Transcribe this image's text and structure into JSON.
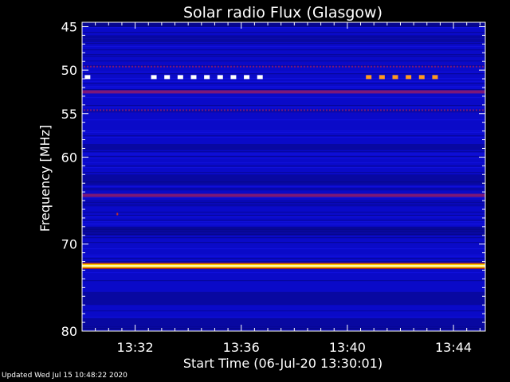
{
  "chart_data": {
    "type": "heatmap",
    "title": "Solar radio Flux (Glasgow)",
    "xlabel": "Start Time (06-Jul-20 13:30:01)",
    "ylabel": "Frequency [MHz]",
    "xlim_minutes": [
      0,
      15.2
    ],
    "ylim_mhz": [
      44.5,
      80
    ],
    "y_inverted": true,
    "x_ticks": [
      {
        "minutes": 2,
        "label": "13:32"
      },
      {
        "minutes": 6,
        "label": "13:36"
      },
      {
        "minutes": 10,
        "label": "13:40"
      },
      {
        "minutes": 14,
        "label": "13:44"
      }
    ],
    "y_ticks": [
      {
        "mhz": 45,
        "label": "45"
      },
      {
        "mhz": 50,
        "label": "50"
      },
      {
        "mhz": 55,
        "label": "55"
      },
      {
        "mhz": 60,
        "label": "60"
      },
      {
        "mhz": 70,
        "label": "70"
      },
      {
        "mhz": 80,
        "label": "80"
      }
    ],
    "y_minor_ticks_mhz": [
      46,
      47,
      48,
      49,
      51,
      52,
      53,
      54,
      56,
      57,
      58,
      59,
      61,
      62,
      63,
      64,
      65,
      66,
      67,
      68,
      69,
      71,
      72,
      73,
      74,
      75,
      76,
      77,
      78,
      79
    ],
    "x_minor_ticks_minutes": [
      0.5,
      1,
      1.5,
      2.5,
      3,
      3.5,
      4,
      4.5,
      5,
      5.5,
      6.5,
      7,
      7.5,
      8,
      8.5,
      9,
      9.5,
      10.5,
      11,
      11.5,
      12,
      12.5,
      13,
      13.5,
      14.5,
      15
    ],
    "colors": {
      "background": "#0a0ac8",
      "dark_band": "#05057a",
      "mid_band": "#1414e6",
      "interference": "#8a1a6e",
      "strong": "#ffd200",
      "white_dash": "#ffffff",
      "orange_dash": "#ff9a20"
    },
    "interference_bands_mhz": [
      {
        "mhz": 49.6,
        "intensity": "dotted"
      },
      {
        "mhz": 52.5,
        "intensity": "medium"
      },
      {
        "mhz": 54.6,
        "intensity": "dotted"
      },
      {
        "mhz": 64.4,
        "intensity": "medium"
      },
      {
        "mhz": 72.5,
        "intensity": "strong"
      }
    ],
    "dash_series": [
      {
        "mhz": 50.8,
        "color": "white",
        "minutes": [
          0.1,
          2.6,
          3.1,
          3.6,
          4.1,
          4.6,
          5.1,
          5.6,
          6.1,
          6.6
        ]
      },
      {
        "mhz": 50.8,
        "color": "orange",
        "minutes": [
          10.7,
          11.2,
          11.7,
          12.2,
          12.7,
          13.2
        ]
      }
    ]
  },
  "footer": {
    "updated": "Updated Wed Jul 15 10:48:22 2020"
  }
}
